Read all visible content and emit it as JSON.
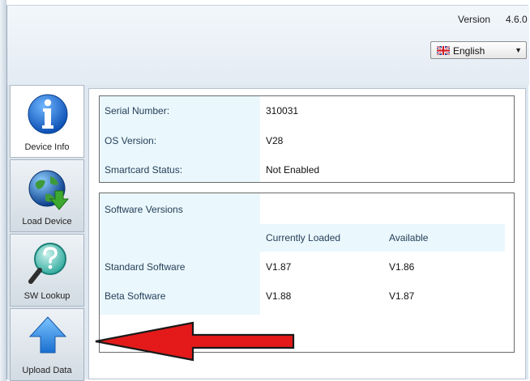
{
  "header": {
    "version_label": "Version",
    "version_number": "4.6.0",
    "language": {
      "selected": "English",
      "flag_icon": "uk-flag-icon"
    }
  },
  "sidebar": {
    "items": [
      {
        "label": "Device Info",
        "icon": "info-icon"
      },
      {
        "label": "Load Device",
        "icon": "globe-download-icon"
      },
      {
        "label": "SW Lookup",
        "icon": "magnifier-question-icon"
      },
      {
        "label": "Upload Data",
        "icon": "arrow-up-icon"
      }
    ]
  },
  "device_info": {
    "rows": [
      {
        "label": "Serial Number:",
        "value": "310031"
      },
      {
        "label": "OS Version:",
        "value": "V28"
      },
      {
        "label": "Smartcard Status:",
        "value": "Not Enabled"
      }
    ]
  },
  "software": {
    "section_label": "Software Versions",
    "columns": [
      "Currently Loaded",
      "Available"
    ],
    "rows": [
      {
        "label": "Standard Software",
        "loaded": "V1.87",
        "available": "V1.86"
      },
      {
        "label": "Beta Software",
        "loaded": "V1.88",
        "available": "V1.87"
      }
    ]
  },
  "colors": {
    "accent_blue": "#1e6ec8",
    "panel_tint": "#eaf7fc",
    "annotation_arrow": "#e41a1a"
  }
}
